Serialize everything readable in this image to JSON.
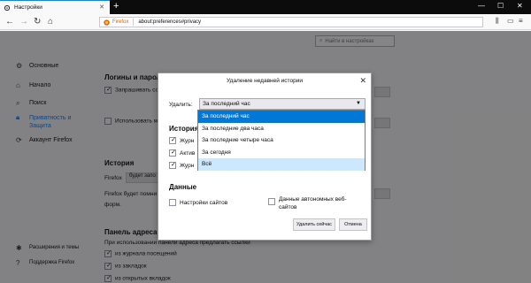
{
  "browser": {
    "tab_title": "Настройки",
    "url_identity": "Firefox",
    "url": "about:preferences#privacy",
    "new_tab": "+",
    "controls": {
      "minimize": "—",
      "maximize": "☐",
      "close": "✕"
    }
  },
  "sidebar": {
    "items": [
      {
        "label": "Основные",
        "icon": "gear-icon"
      },
      {
        "label": "Начало",
        "icon": "home-icon"
      },
      {
        "label": "Поиск",
        "icon": "search-icon"
      },
      {
        "label": "Приватность и",
        "label2": "Защита",
        "icon": "lock-icon",
        "active": true
      },
      {
        "label": "Аккаунт Firefox",
        "icon": "sync-icon"
      }
    ],
    "footer": [
      {
        "label": "Расширения и темы",
        "icon": "puzzle-icon"
      },
      {
        "label": "Поддержка Firefox",
        "icon": "help-icon"
      }
    ]
  },
  "page": {
    "search_placeholder": "Найти в настройках",
    "logins_title": "Логины и пароли",
    "logins_ask": "Запрашивать со",
    "logins_use": "Использовать м",
    "history_title": "История",
    "history_will": "Firefox",
    "history_btn": "будет запо",
    "history_desc1": "Firefox будет помни",
    "history_desc2": "форм.",
    "address_title": "Панель адреса",
    "address_desc": "При использовании панели адреса предлагать ссылки",
    "address_opt1": "из журнала посещений",
    "address_opt2": "из закладок",
    "address_opt3": "из открытых вкладок"
  },
  "dialog": {
    "title": "Удаление недавней истории",
    "delete_label": "Удалить:",
    "selected_range": "За последний час",
    "history_section": "История",
    "history_items": [
      "Журн",
      "Актив",
      "Журн"
    ],
    "data_section": "Данные",
    "site_settings": "Настройки сайтов",
    "offline_data_line1": "Данные автономных веб-",
    "offline_data_line2": "сайтов",
    "delete_now": "Удалить сейчас",
    "cancel": "Отмена"
  },
  "dropdown": {
    "options": [
      "За последний час",
      "За последние два часа",
      "За последние четыре часа",
      "За сегодня",
      "Всё"
    ],
    "selected_index": 0,
    "hover_index": 4
  },
  "colors": {
    "accent": "#0a84ff",
    "selected": "#0078d7",
    "hover": "#cce8ff"
  }
}
